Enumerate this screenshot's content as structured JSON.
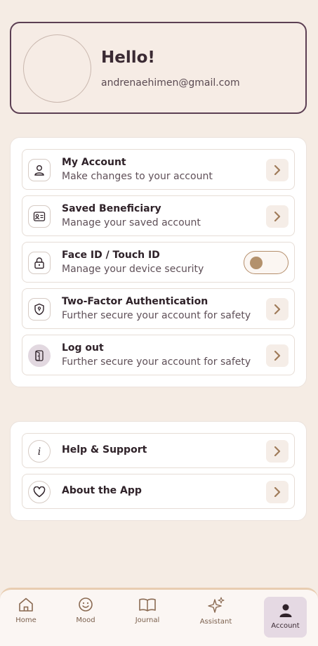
{
  "profile": {
    "greeting": "Hello!",
    "email": "andrenaehimen@gmail.com"
  },
  "settings": {
    "account_items": [
      {
        "title": "My Account",
        "subtitle": "Make changes to your account",
        "icon": "user-icon",
        "control": "chevron"
      },
      {
        "title": "Saved Beneficiary",
        "subtitle": "Manage your saved account",
        "icon": "id-card-icon",
        "control": "chevron"
      },
      {
        "title": "Face ID / Touch ID",
        "subtitle": "Manage your device security",
        "icon": "lock-icon",
        "control": "toggle",
        "toggle_on": false
      },
      {
        "title": "Two-Factor Authentication",
        "subtitle": "Further secure your account for safety",
        "icon": "shield-icon",
        "control": "chevron"
      },
      {
        "title": "Log out",
        "subtitle": "Further secure your account for safety",
        "icon": "logout-icon",
        "control": "chevron"
      }
    ],
    "more_items": [
      {
        "title": "Help & Support",
        "icon": "info-icon"
      },
      {
        "title": "About the App",
        "icon": "heart-icon"
      }
    ]
  },
  "nav": {
    "items": [
      {
        "label": "Home",
        "icon": "home-icon"
      },
      {
        "label": "Mood",
        "icon": "smiley-icon"
      },
      {
        "label": "Journal",
        "icon": "book-icon"
      },
      {
        "label": "Assistant",
        "icon": "sparkle-icon"
      },
      {
        "label": "Account",
        "icon": "person-icon",
        "active": true
      }
    ]
  },
  "colors": {
    "background": "#f5ece4",
    "accent": "#5c3f53",
    "chevron": "#a07c5a",
    "nav_active_bg": "#e5d9e3"
  }
}
